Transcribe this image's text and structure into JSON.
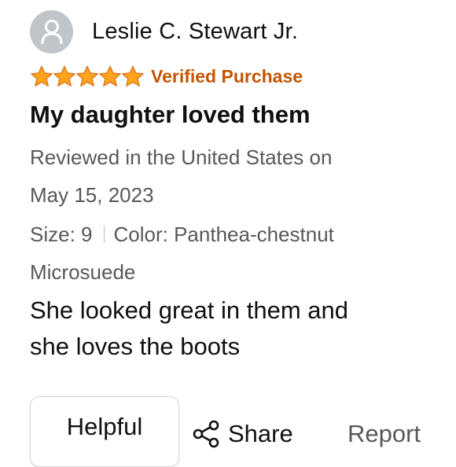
{
  "reviewer": {
    "name": "Leslie C. Stewart Jr.",
    "avatar_icon": "user-icon"
  },
  "rating": {
    "stars": 5,
    "max_stars": 5,
    "star_color": "#ffa41c",
    "verified_label": "Verified Purchase",
    "verified_color": "#c45500"
  },
  "review": {
    "title": "My daughter loved them",
    "meta_line1": "Reviewed in the United States on",
    "meta_line2": "May 15, 2023",
    "size_label": "Size: 9",
    "color_label": "Color: Panthea-chestnut",
    "color_line2": "Microsuede",
    "body_line1": "She looked great in them and",
    "body_line2": "she loves the boots"
  },
  "actions": {
    "helpful_label": "Helpful",
    "share_label": "Share",
    "share_icon": "share-icon",
    "report_label": "Report"
  }
}
